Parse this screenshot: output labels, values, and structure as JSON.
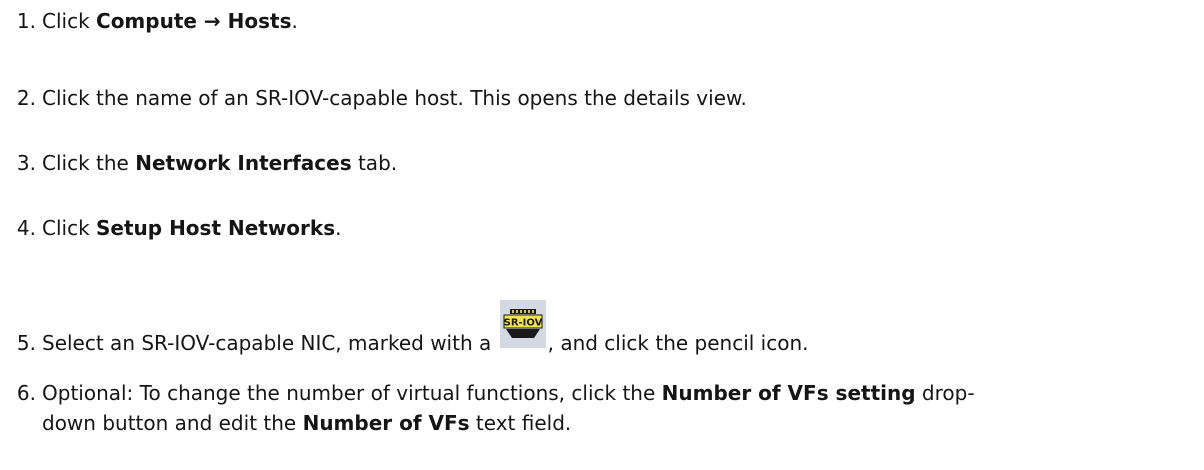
{
  "steps": [
    {
      "number": "1.",
      "pre": "Click ",
      "bold1": "Compute → Hosts",
      "post": "."
    },
    {
      "number": "2.",
      "text": "Click the name of an SR-IOV-capable host. This opens the details view."
    },
    {
      "number": "3.",
      "pre": "Click the ",
      "bold1": "Network Interfaces",
      "post": " tab."
    },
    {
      "number": "4.",
      "pre": "Click ",
      "bold1": "Setup Host Networks",
      "post": "."
    },
    {
      "number": "5.",
      "pre": "Select an SR-IOV-capable NIC, marked with a ",
      "icon": "sr-iov-nic-icon",
      "icon_label": "SR-IOV",
      "post": ", and click the pencil icon."
    },
    {
      "number": "6.",
      "pre": "Optional: To change the number of virtual functions, click the ",
      "bold1": "Number of VFs setting",
      "mid": " drop-",
      "line2_pre": "down button and edit the ",
      "bold2": "Number of VFs",
      "post": " text field."
    }
  ]
}
